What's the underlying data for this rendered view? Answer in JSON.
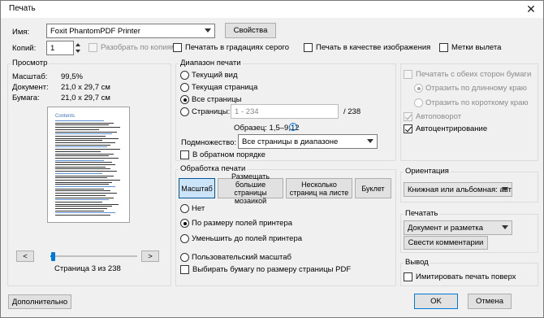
{
  "window": {
    "title": "Печать",
    "close_icon": "close-icon"
  },
  "printer": {
    "name_label": "Имя:",
    "name_value": "Foxit PhantomPDF Printer",
    "properties_button": "Свойства",
    "copies_label": "Копий:",
    "copies_value": "1",
    "collate_label": "Разобрать по копиям",
    "grayscale_label": "Печатать в градациях серого",
    "as_image_label": "Печать в качестве изображения",
    "bleed_marks_label": "Метки вылета"
  },
  "preview": {
    "title": "Просмотр",
    "rows": [
      {
        "label": "Масштаб:",
        "value": "99,5%"
      },
      {
        "label": "Документ:",
        "value": "21,0 x 29,7 см"
      },
      {
        "label": "Бумага:",
        "value": "21,0 x 29,7 см"
      }
    ],
    "page_heading": "Contents",
    "prev_button": "<",
    "next_button": ">",
    "page_indicator": "Страница 3 из 238",
    "slider_position": 0.01
  },
  "print_range": {
    "title": "Диапазон печати",
    "current_view": "Текущий вид",
    "current_page": "Текущая страница",
    "all_pages": "Все страницы",
    "pages_label": "Страницы:",
    "pages_placeholder": "1 - 234",
    "pages_total": "/ 238",
    "sample_label": "Образец: 1,5–9,12",
    "subset_label": "Подмножество:",
    "subset_value": "Все страницы в диапазоне",
    "reverse_label": "В обратном порядке"
  },
  "handling": {
    "title": "Обработка печати",
    "tabs": [
      "Масштаб",
      "Размещать большие страницы мозаикой",
      "Несколько страниц на листе",
      "Буклет"
    ],
    "none": "Нет",
    "fit_margins": "По размеру полей принтера",
    "shrink_margins": "Уменьшить до полей принтера",
    "custom_scale": "Пользовательский масштаб",
    "choose_paper": "Выбирать бумагу по размеру страницы PDF"
  },
  "duplex": {
    "both_sides": "Печатать с обеих сторон бумаги",
    "long_edge": "Отразить по длинному краю",
    "short_edge": "Отразить по короткому краю",
    "auto_rotate": "Автоповорот",
    "auto_center": "Автоцентрирование"
  },
  "orientation": {
    "title": "Ориентация",
    "value": "Книжная или альбомная: авто"
  },
  "print_what": {
    "title": "Печатать",
    "value": "Документ и разметка",
    "summarize_button": "Свести комментарии"
  },
  "output": {
    "title": "Вывод",
    "simulate_overprint": "Имитировать печать поверх"
  },
  "footer": {
    "advanced_button": "Дополнительно",
    "ok_button": "OK",
    "cancel_button": "Отмена"
  },
  "colors": {
    "accent": "#0078d7",
    "active_tab": "#cce4f7"
  }
}
